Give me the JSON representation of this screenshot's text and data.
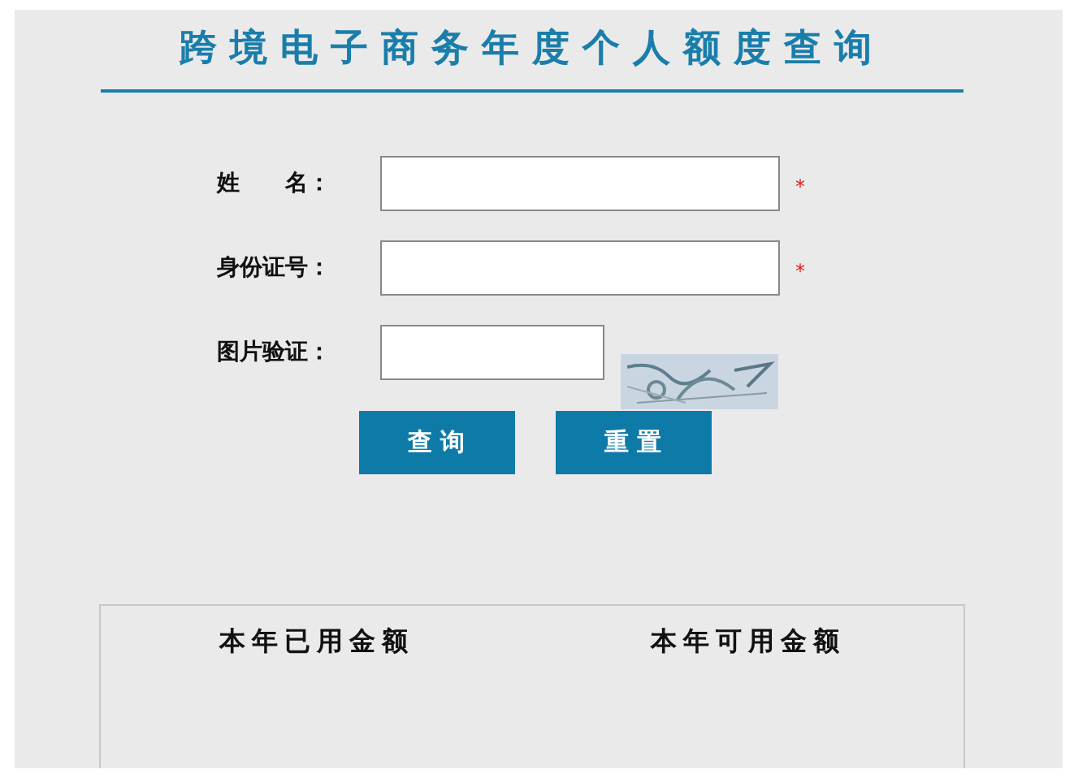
{
  "title": "跨境电子商务年度个人额度查询",
  "fields": [
    {
      "kind": "text",
      "label": "姓　　名：",
      "required_mark": "*"
    },
    {
      "kind": "text",
      "label": "身份证号：",
      "required_mark": "*"
    },
    {
      "kind": "captcha",
      "label": "图片验证："
    }
  ],
  "buttons": [
    "查 询",
    "重 置"
  ],
  "result_columns": [
    "本年已用金额",
    "本年可用金额"
  ]
}
